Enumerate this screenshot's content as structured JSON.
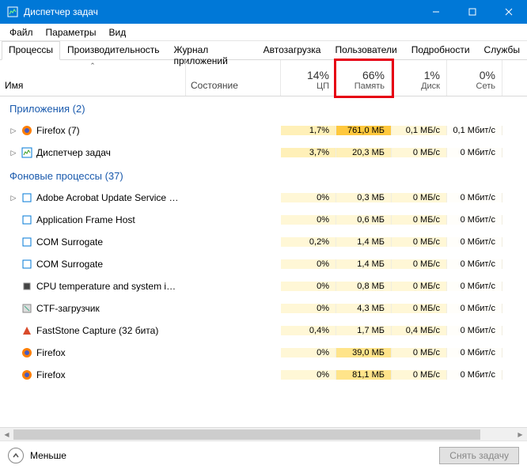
{
  "window": {
    "title": "Диспетчер задач"
  },
  "menu": {
    "file": "Файл",
    "params": "Параметры",
    "view": "Вид"
  },
  "tabs": {
    "processes": "Процессы",
    "performance": "Производительность",
    "app_history": "Журнал приложений",
    "startup": "Автозагрузка",
    "users": "Пользователи",
    "details": "Подробности",
    "services": "Службы"
  },
  "columns": {
    "name": "Имя",
    "state": "Состояние",
    "cpu": {
      "pct": "14%",
      "label": "ЦП"
    },
    "memory": {
      "pct": "66%",
      "label": "Память"
    },
    "disk": {
      "pct": "1%",
      "label": "Диск"
    },
    "net": {
      "pct": "0%",
      "label": "Сеть"
    }
  },
  "groups": {
    "apps": "Приложения (2)",
    "background": "Фоновые процессы (37)"
  },
  "rows": {
    "firefox7": {
      "name": "Firefox (7)",
      "cpu": "1,7%",
      "mem": "761,0 МБ",
      "disk": "0,1 МБ/с",
      "net": "0,1 Мбит/с"
    },
    "taskmgr": {
      "name": "Диспетчер задач",
      "cpu": "3,7%",
      "mem": "20,3 МБ",
      "disk": "0 МБ/с",
      "net": "0 Мбит/с"
    },
    "acrobat": {
      "name": "Adobe Acrobat Update Service (...",
      "cpu": "0%",
      "mem": "0,3 МБ",
      "disk": "0 МБ/с",
      "net": "0 Мбит/с"
    },
    "appframe": {
      "name": "Application Frame Host",
      "cpu": "0%",
      "mem": "0,6 МБ",
      "disk": "0 МБ/с",
      "net": "0 Мбит/с"
    },
    "com1": {
      "name": "COM Surrogate",
      "cpu": "0,2%",
      "mem": "1,4 МБ",
      "disk": "0 МБ/с",
      "net": "0 Мбит/с"
    },
    "com2": {
      "name": "COM Surrogate",
      "cpu": "0%",
      "mem": "1,4 МБ",
      "disk": "0 МБ/с",
      "net": "0 Мбит/с"
    },
    "cputemp": {
      "name": "CPU temperature and system in...",
      "cpu": "0%",
      "mem": "0,8 МБ",
      "disk": "0 МБ/с",
      "net": "0 Мбит/с"
    },
    "ctf": {
      "name": "CTF-загрузчик",
      "cpu": "0%",
      "mem": "4,3 МБ",
      "disk": "0 МБ/с",
      "net": "0 Мбит/с"
    },
    "faststone": {
      "name": "FastStone Capture (32 бита)",
      "cpu": "0,4%",
      "mem": "1,7 МБ",
      "disk": "0,4 МБ/с",
      "net": "0 Мбит/с"
    },
    "firefox_a": {
      "name": "Firefox",
      "cpu": "0%",
      "mem": "39,0 МБ",
      "disk": "0 МБ/с",
      "net": "0 Мбит/с"
    },
    "firefox_b": {
      "name": "Firefox",
      "cpu": "0%",
      "mem": "81,1 МБ",
      "disk": "0 МБ/с",
      "net": "0 Мбит/с"
    }
  },
  "footer": {
    "less": "Меньше",
    "end_task": "Снять задачу"
  }
}
